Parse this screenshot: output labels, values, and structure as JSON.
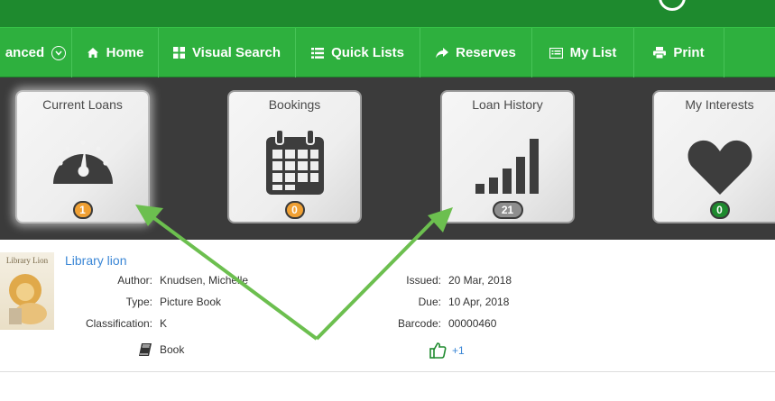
{
  "nav": {
    "items": [
      {
        "label": "anced"
      },
      {
        "label": "Home"
      },
      {
        "label": "Visual Search"
      },
      {
        "label": "Quick Lists"
      },
      {
        "label": "Reserves"
      },
      {
        "label": "My List"
      },
      {
        "label": "Print"
      }
    ]
  },
  "tiles": [
    {
      "title": "Current Loans",
      "count": "1",
      "badge_color": "#f0a033"
    },
    {
      "title": "Bookings",
      "count": "0",
      "badge_color": "#f0a033"
    },
    {
      "title": "Loan History",
      "count": "21",
      "badge_color": "#8e8e8e"
    },
    {
      "title": "My Interests",
      "count": "0",
      "badge_color": "#1e8a2e"
    }
  ],
  "record": {
    "cover_text": "Library Lion",
    "title": "Library lion",
    "labels": {
      "author": "Author:",
      "type": "Type:",
      "classification": "Classification:",
      "issued": "Issued:",
      "due": "Due:",
      "barcode": "Barcode:"
    },
    "values": {
      "author": "Knudsen, Michelle",
      "type": "Picture Book",
      "classification": "K",
      "issued": "20 Mar, 2018",
      "due": "10 Apr, 2018",
      "barcode": "00000460"
    },
    "format_label": "Book",
    "rating_label": "+1"
  },
  "colors": {
    "topbar": "#1e8a2e",
    "navbar": "#2eb03e",
    "dashboard": "#3b3b3b",
    "link": "#3b87d6",
    "annotation_arrow": "#6cbf4f"
  }
}
